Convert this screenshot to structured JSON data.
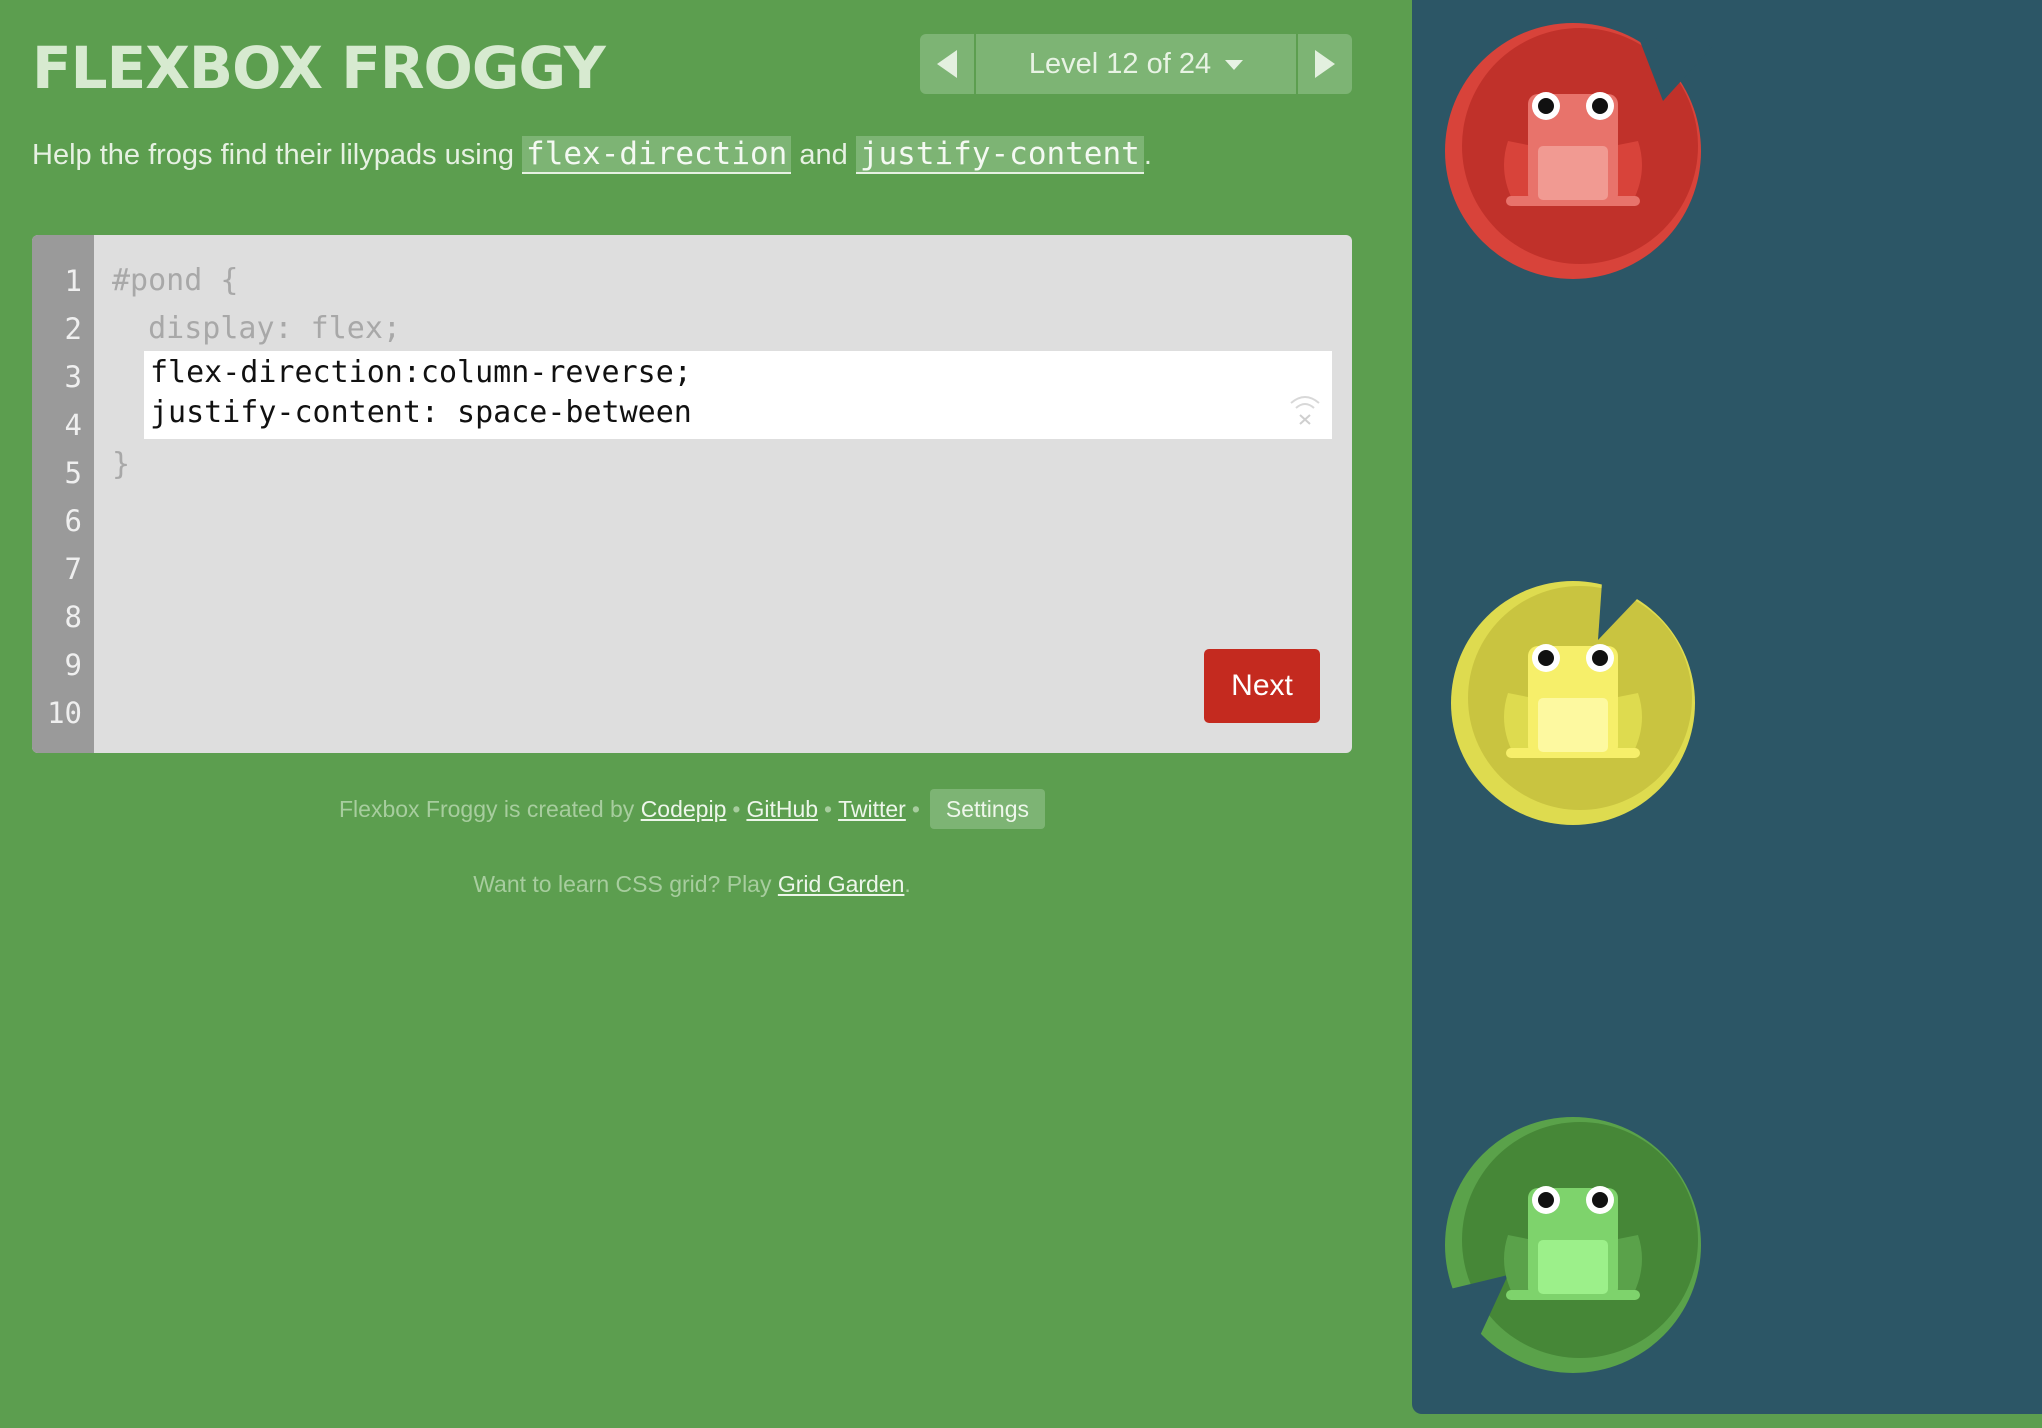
{
  "header": {
    "title": "FLEXBOX FROGGY"
  },
  "level_nav": {
    "level_text": "Level 12 of 24"
  },
  "instructions": {
    "prefix": "Help the frogs find their lilypads using ",
    "code1": "flex-direction",
    "middle": " and ",
    "code2": "justify-content",
    "suffix": "."
  },
  "editor": {
    "line_numbers": [
      "1",
      "2",
      "3",
      "4",
      "5",
      "6",
      "7",
      "8",
      "9",
      "10"
    ],
    "line1": "#pond {",
    "line2": "  display: flex;",
    "input_value": "flex-direction:column-reverse;\njustify-content: space-between",
    "closing": "}",
    "next_label": "Next"
  },
  "footer": {
    "credit_prefix": "Flexbox Froggy is created by ",
    "codepip": "Codepip",
    "bullet": "•",
    "github": "GitHub",
    "twitter": "Twitter",
    "settings": "Settings",
    "promo_prefix": "Want to learn CSS grid? Play ",
    "grid_garden": "Grid Garden",
    "promo_suffix": "."
  },
  "pond": {
    "items": [
      {
        "color": "red",
        "pad": "#c0312a",
        "pad_rim": "#d8433a",
        "frog": "#e8736b",
        "belly": "#f19a92"
      },
      {
        "color": "yellow",
        "pad": "#c9c440",
        "pad_rim": "#dedb4f",
        "frog": "#f6ef6a",
        "belly": "#fdf9a0"
      },
      {
        "color": "green",
        "pad": "#468737",
        "pad_rim": "#5aa24a",
        "frog": "#7ed36c",
        "belly": "#9cf08a"
      }
    ]
  },
  "colors": {
    "background": "#5c9e4f",
    "pond": "#2c5666",
    "next_button": "#c42a1f"
  }
}
